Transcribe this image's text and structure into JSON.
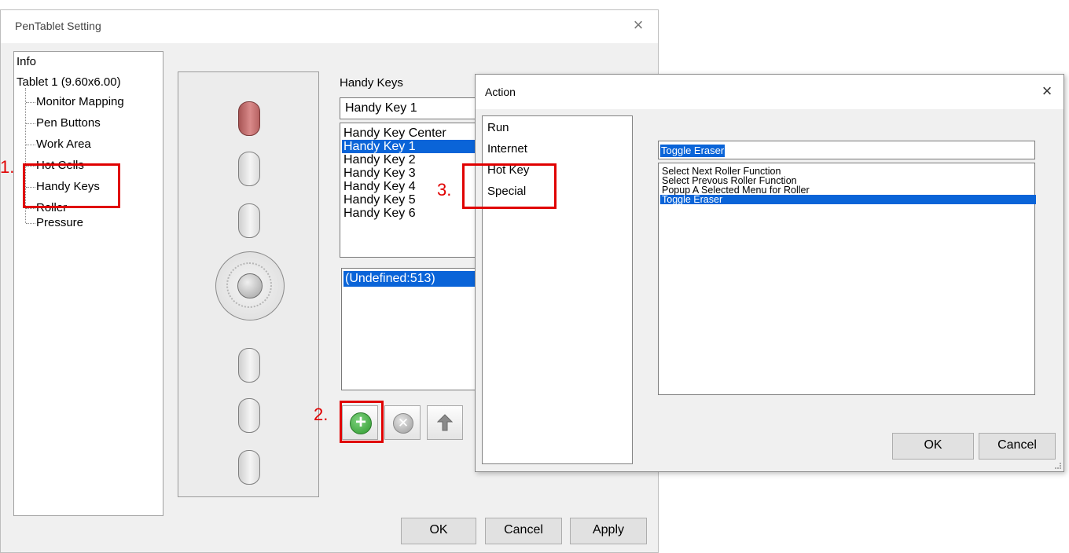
{
  "main_window": {
    "title": "PenTablet Setting",
    "close_glyph": "×",
    "tree": {
      "info": "Info",
      "tablet": "Tablet  1 (9.60x6.00)",
      "children": [
        "Monitor Mapping",
        "Pen Buttons",
        "Work Area",
        "Hot Cells",
        "Handy Keys",
        "Roller",
        "Pressure"
      ]
    },
    "handy_keys": {
      "label": "Handy Keys",
      "combo_value": "Handy Key 1",
      "list": [
        "Handy Key Center",
        "Handy Key 1",
        "Handy Key 2",
        "Handy Key 3",
        "Handy Key 4",
        "Handy Key 5",
        "Handy Key 6"
      ],
      "selected": "Handy Key 1"
    },
    "action_list": [
      "(Undefined:513)"
    ],
    "toolbar": {
      "add_icon": "plus-icon",
      "remove_icon": "x-circle-icon",
      "up_icon": "arrow-up-icon"
    },
    "buttons": {
      "ok": "OK",
      "cancel": "Cancel",
      "apply": "Apply"
    }
  },
  "action_dialog": {
    "title": "Action",
    "close_glyph": "×",
    "categories": [
      "Run",
      "Internet",
      "Hot Key",
      "Special"
    ],
    "input_value": "Toggle Eraser",
    "functions": [
      "Select Next Roller Function",
      "Select Prevous Roller Function",
      "Popup A Selected Menu for Roller",
      "Toggle Eraser"
    ],
    "selected_function": "Toggle Eraser",
    "buttons": {
      "ok": "OK",
      "cancel": "Cancel"
    }
  },
  "annotations": [
    "1.",
    "2.",
    "3."
  ],
  "colors": {
    "selection": "#0a64d8",
    "annotation": "#e00000",
    "active_tablet_button": "#c97070"
  }
}
